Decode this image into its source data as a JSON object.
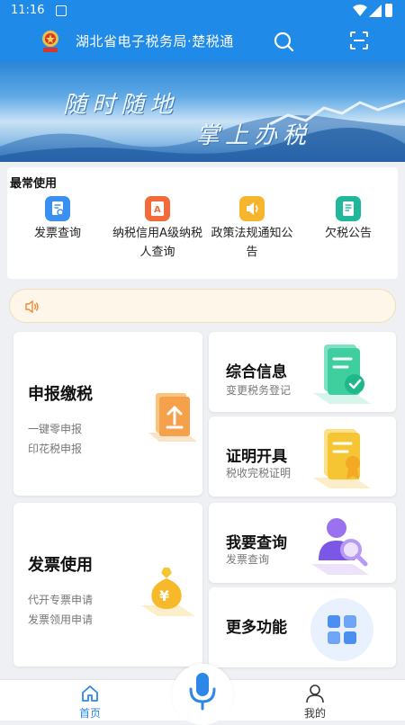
{
  "status_bar": {
    "time": "11:16"
  },
  "app_bar": {
    "title": "湖北省电子税务局·楚税通"
  },
  "banner": {
    "line1": "随时随地",
    "line2": "掌上办税"
  },
  "frequent": {
    "title": "最常使用",
    "items": [
      {
        "label": "发票查询",
        "icon": "invoice-search-icon",
        "color": "#3b8ff0"
      },
      {
        "label": "纳税信用A级纳税人查询",
        "icon": "credit-rating-icon",
        "color": "#f36b3b"
      },
      {
        "label": "政策法规通知公告",
        "icon": "speaker-icon",
        "color": "#f5b52e"
      },
      {
        "label": "欠税公告",
        "icon": "tax-notice-icon",
        "color": "#21b79a"
      }
    ]
  },
  "notice": {
    "text": ""
  },
  "cards": {
    "declare": {
      "title": "申报缴税",
      "lines": [
        "一键零申报",
        "印花税申报"
      ]
    },
    "info": {
      "title": "综合信息",
      "sub": "变更税务登记"
    },
    "cert": {
      "title": "证明开具",
      "sub": "税收完税证明"
    },
    "invoice": {
      "title": "发票使用",
      "lines": [
        "代开专票申请",
        "发票领用申请"
      ]
    },
    "query": {
      "title": "我要查询",
      "sub": "发票查询"
    },
    "more": {
      "title": "更多功能"
    }
  },
  "bottom_nav": {
    "home": "首页",
    "mine": "我的",
    "active_color": "#2d87e6"
  }
}
